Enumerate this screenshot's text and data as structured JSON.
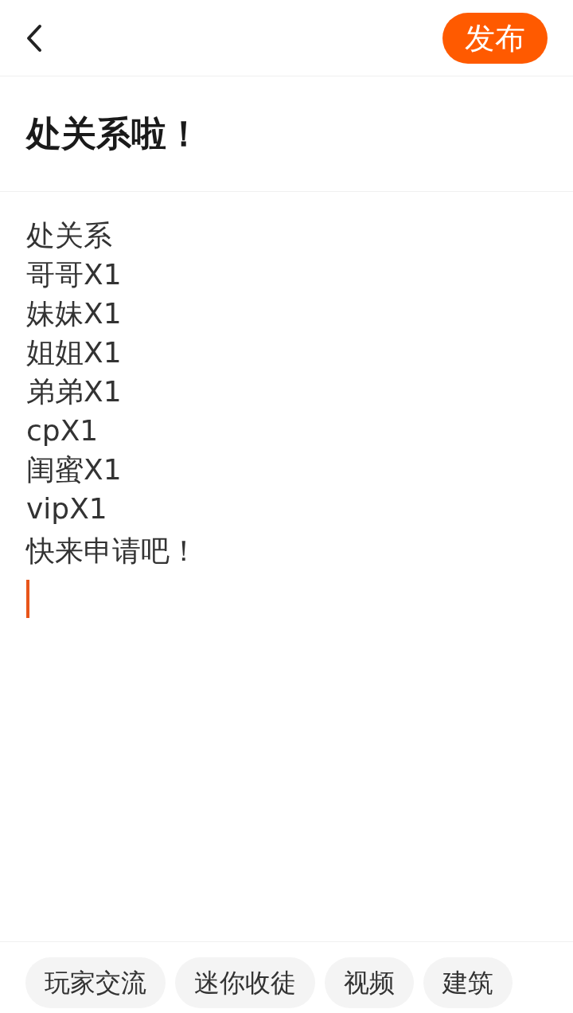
{
  "header": {
    "publish_button": "发布"
  },
  "title": "处关系啦！",
  "body": {
    "lines": [
      "处关系",
      "哥哥X1",
      "妹妹X1",
      "姐姐X1",
      "弟弟X1",
      "cpX1",
      "闺蜜X1",
      "vipX1",
      "快来申请吧！"
    ]
  },
  "topics": [
    "玩家交流",
    "迷你收徒",
    "视频",
    "建筑"
  ]
}
